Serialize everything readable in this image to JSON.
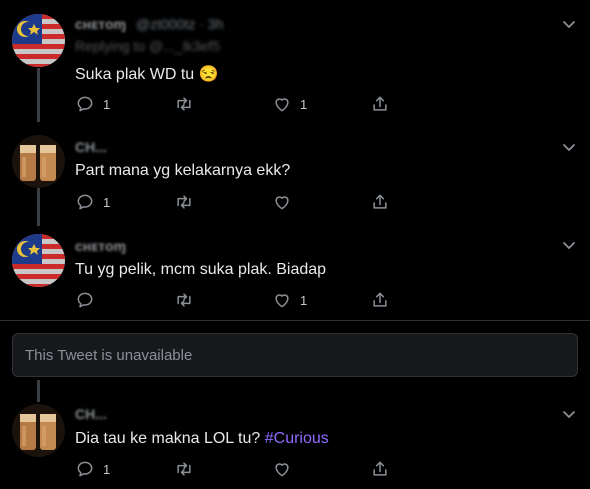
{
  "tweets": [
    {
      "name": "cʜᴇтᴏɱ",
      "handle_time": "@zt000tz · 3h",
      "reply_line": "Replying to @..._lk3ef5",
      "text": "Suka plak WD tu",
      "emoji": "😒",
      "reply_count": "1",
      "retweet_count": "",
      "like_count": "1",
      "avatar": "flag-avatar"
    },
    {
      "name": "CH...",
      "text": "Part mana yg kelakarnya ekk?",
      "reply_count": "1",
      "retweet_count": "",
      "like_count": "",
      "avatar": "drink-avatar"
    },
    {
      "name": "cʜᴇтᴏɱ",
      "text": "Tu yg pelik, mcm suka plak. Biadap",
      "reply_count": "",
      "retweet_count": "",
      "like_count": "1",
      "avatar": "flag-avatar"
    },
    {
      "name": "CH...",
      "text": "Dia tau ke makna LOL tu?",
      "hashtag": "#Curious",
      "reply_count": "1",
      "retweet_count": "",
      "like_count": "",
      "avatar": "drink-avatar"
    }
  ],
  "unavailable_text": "This Tweet is unavailable",
  "colors": {
    "background": "#000000",
    "text": "#e7e9ea",
    "muted": "#8b9096",
    "hashtag": "#8f6bff"
  },
  "icons": [
    "reply-icon",
    "retweet-icon",
    "like-icon",
    "share-icon",
    "chevron-down-icon"
  ]
}
